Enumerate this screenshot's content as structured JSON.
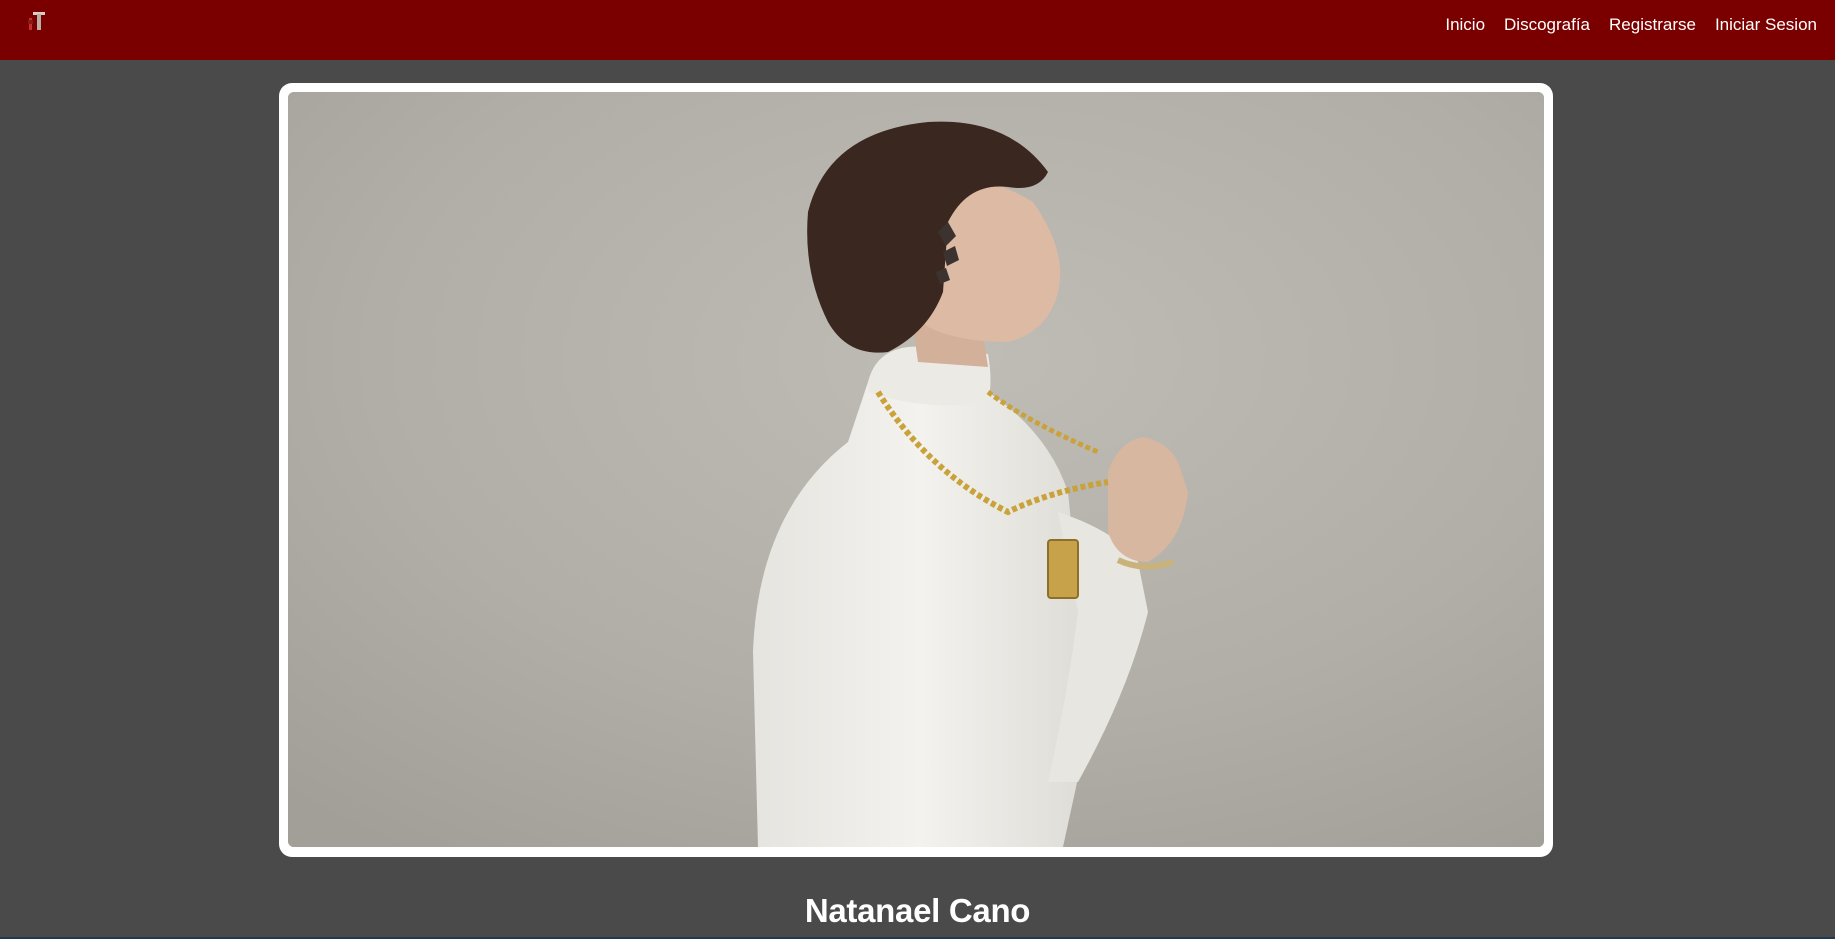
{
  "navbar": {
    "logo_icon": "guitar-logo-icon",
    "links": [
      {
        "label": "Inicio"
      },
      {
        "label": "Discografía"
      },
      {
        "label": "Registrarse"
      },
      {
        "label": "Iniciar Sesion"
      }
    ]
  },
  "hero": {
    "image_subject": "artist-portrait"
  },
  "artist": {
    "name": "Natanael Cano"
  },
  "colors": {
    "navbar_bg": "#7a0000",
    "page_bg": "#4a4a4a",
    "frame_bg": "#ffffff",
    "text": "#ffffff"
  }
}
